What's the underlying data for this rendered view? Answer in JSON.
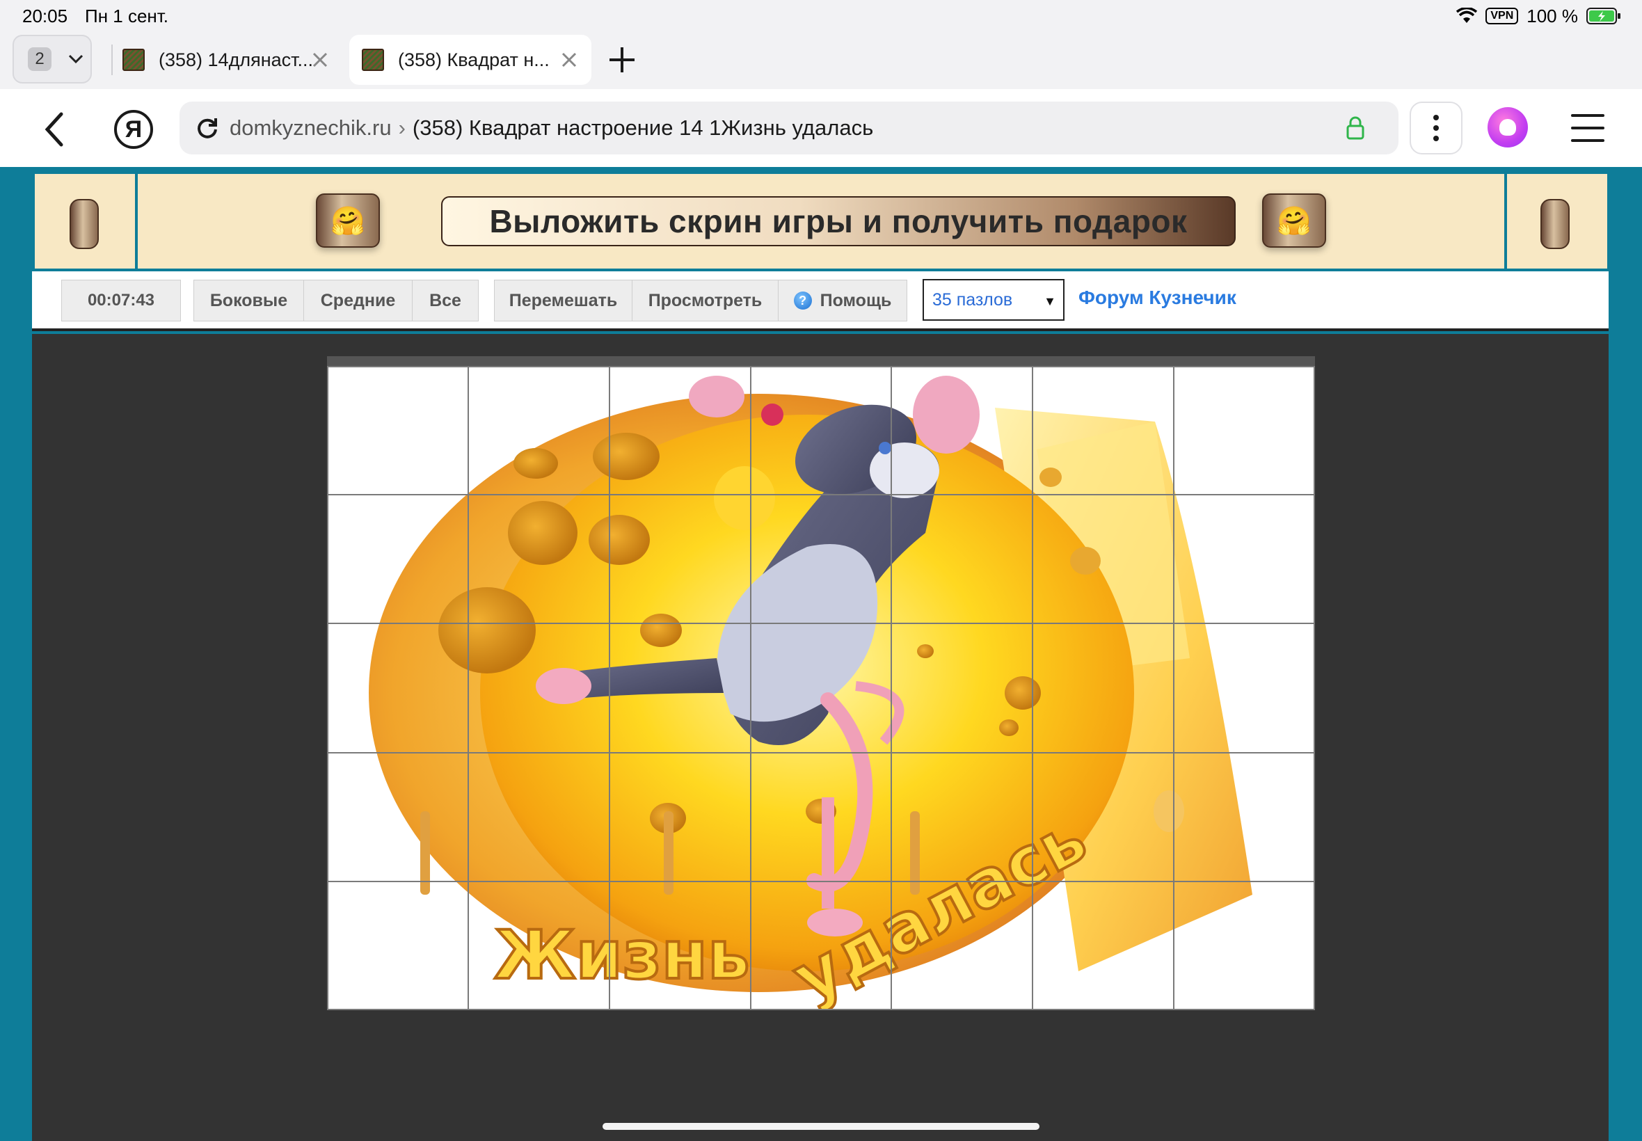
{
  "status": {
    "time": "20:05",
    "date": "Пн 1 сент.",
    "vpn": "VPN",
    "battery": "100 %"
  },
  "tabs": {
    "count": "2",
    "items": [
      {
        "title": "(358) 14длянаст..."
      },
      {
        "title": "(358) Квадрат н..."
      }
    ]
  },
  "address": {
    "domain": "domkyznechik.ru",
    "separator": "›",
    "title": "(358) Квадрат настроение 14 1Жизнь удалась",
    "yandex": "Я"
  },
  "banner": {
    "label": "Выложить скрин игры и получить подарок",
    "emoji": "🤗"
  },
  "toolbar": {
    "timer": "00:07:43",
    "filter_buttons": [
      "Боковые",
      "Средние",
      "Все"
    ],
    "action_buttons": [
      "Перемешать",
      "Просмотреть",
      "Помощь"
    ],
    "help_icon": "?",
    "pieces_select": "35 пазлов",
    "forum_link": "Форум Кузнечик"
  },
  "puzzle": {
    "columns": 7,
    "rows": 5,
    "picture_words": [
      "Жизнь",
      "удалась"
    ]
  }
}
